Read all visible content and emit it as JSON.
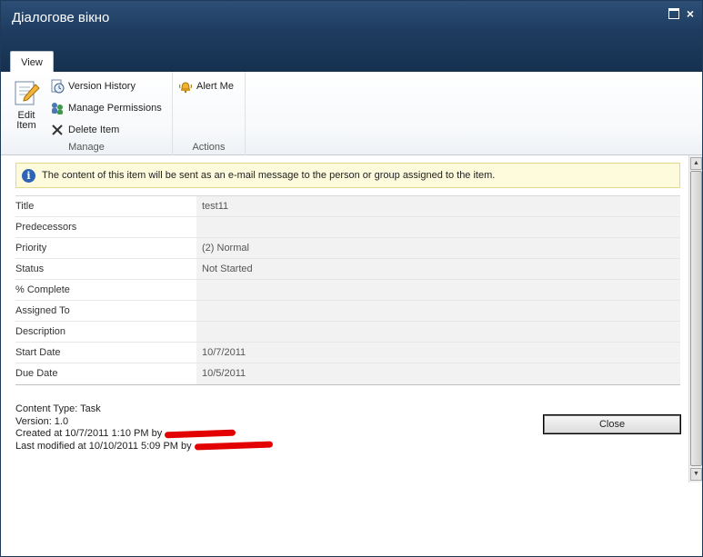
{
  "window": {
    "title": "Діалогове вікно"
  },
  "ribbon": {
    "tab_label": "View",
    "manage": {
      "edit_label_line1": "Edit",
      "edit_label_line2": "Item",
      "version_history": "Version History",
      "manage_permissions": "Manage Permissions",
      "delete_item": "Delete Item",
      "group_label": "Manage"
    },
    "actions": {
      "alert_me": "Alert Me",
      "group_label": "Actions"
    }
  },
  "notice": "The content of this item will be sent as an e-mail message to the person or group assigned to the item.",
  "properties": [
    {
      "name": "Title",
      "value": "test11"
    },
    {
      "name": "Predecessors",
      "value": ""
    },
    {
      "name": "Priority",
      "value": "(2) Normal"
    },
    {
      "name": "Status",
      "value": "Not Started"
    },
    {
      "name": "% Complete",
      "value": ""
    },
    {
      "name": "Assigned To",
      "value": ""
    },
    {
      "name": "Description",
      "value": ""
    },
    {
      "name": "Start Date",
      "value": "10/7/2011"
    },
    {
      "name": "Due Date",
      "value": "10/5/2011"
    }
  ],
  "meta": {
    "content_type": "Content Type: Task",
    "version": "Version: 1.0",
    "created": "Created at 10/7/2011 1:10 PM by",
    "modified": "Last modified at 10/10/2011 5:09 PM by"
  },
  "close_label": "Close",
  "colors": {
    "titlebar": "#1f3d61",
    "notice_bg": "#fdfbdc",
    "info_icon": "#2f63b5",
    "redaction": "#e20000"
  }
}
